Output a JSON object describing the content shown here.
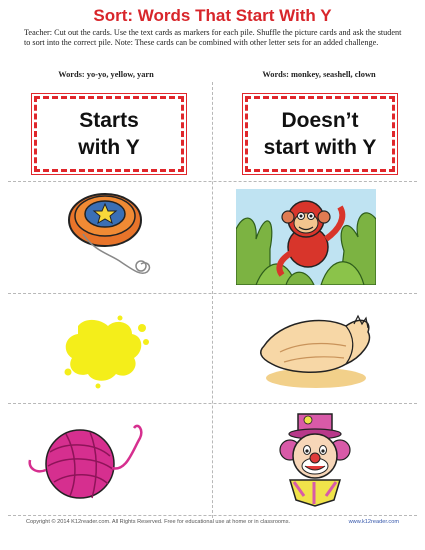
{
  "title": "Sort: Words That Start With Y",
  "instructions": "Teacher: Cut out the cards. Use the text cards as markers for each pile. Shuffle the picture cards and ask the student to sort into the correct pile.  Note: These cards can be combined with other letter sets for an added challenge.",
  "columns": [
    {
      "words": "Words: yo-yo, yellow, yarn",
      "header_line1": "Starts",
      "header_line2": "with Y"
    },
    {
      "words": "Words: monkey, seashell, clown",
      "header_line1": "Doesn’t",
      "header_line2": "start with Y"
    }
  ],
  "pictures": [
    "yo-yo",
    "monkey",
    "yellow",
    "seashell",
    "yarn",
    "clown"
  ],
  "colors": {
    "title": "#d8262b",
    "card_border": "#e0262b"
  },
  "footer": {
    "copyright": "Copyright © 2014  K12reader.com. All Rights Reserved. Free for educational use at home or in classrooms.",
    "url": "www.k12reader.com"
  }
}
